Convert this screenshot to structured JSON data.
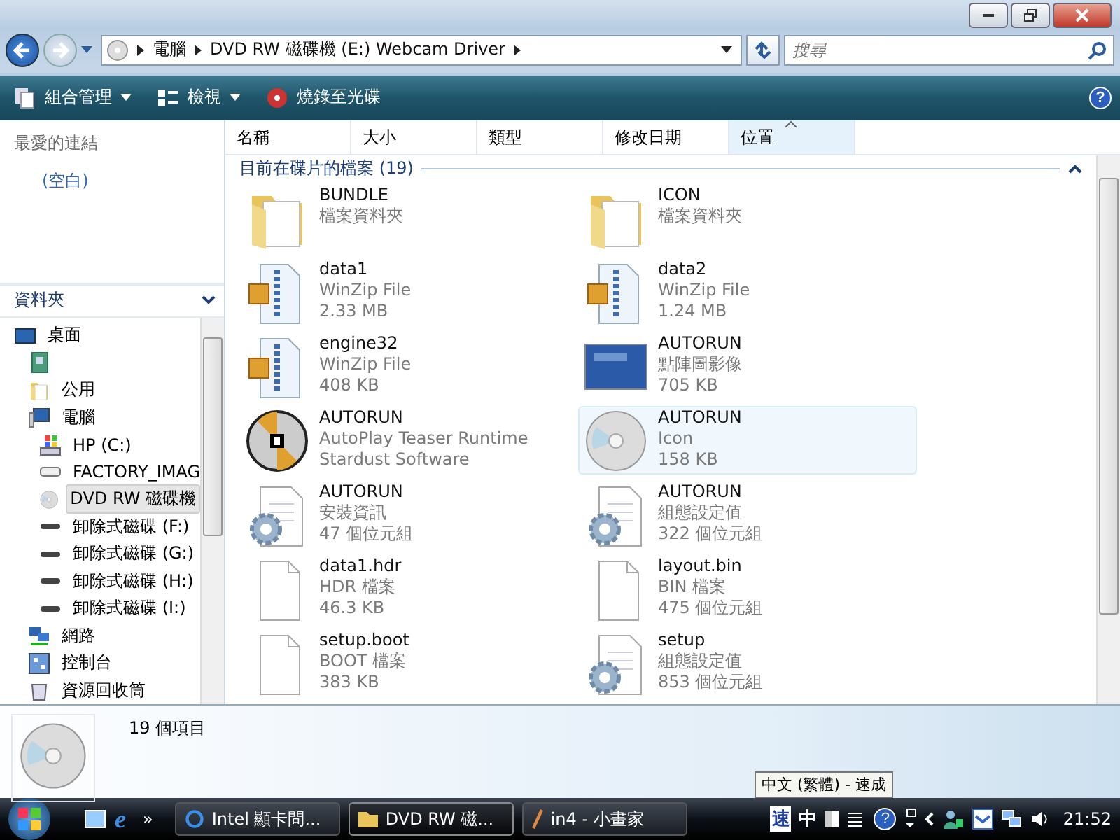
{
  "address_bar": {
    "crumbs": [
      "電腦",
      "DVD RW 磁碟機 (E:) Webcam Driver"
    ]
  },
  "search": {
    "placeholder": "搜尋"
  },
  "toolbar": {
    "help": "?",
    "items": [
      {
        "label": "組合管理",
        "dropdown": true
      },
      {
        "label": "檢視",
        "dropdown": true
      },
      {
        "label": "燒錄至光碟",
        "dropdown": false
      }
    ]
  },
  "favorites": {
    "title": "最愛的連結",
    "empty_text": "(空白)"
  },
  "folders": {
    "title": "資料夾",
    "tree": [
      {
        "label": "桌面",
        "kind": "desktop",
        "selected": false,
        "children": [
          {
            "kind": "contact",
            "selected": false
          },
          {
            "label": "公用",
            "kind": "folder",
            "selected": false
          },
          {
            "label": "電腦",
            "kind": "computer",
            "selected": false,
            "children": [
              {
                "label": "HP (C:)",
                "kind": "sysdrive",
                "selected": false
              },
              {
                "label": "FACTORY_IMAG",
                "kind": "drive",
                "selected": false
              },
              {
                "label": "DVD RW 磁碟機",
                "kind": "cd",
                "selected": true
              },
              {
                "label": "卸除式磁碟 (F:)",
                "kind": "removable",
                "selected": false
              },
              {
                "label": "卸除式磁碟 (G:)",
                "kind": "removable",
                "selected": false
              },
              {
                "label": "卸除式磁碟 (H:)",
                "kind": "removable",
                "selected": false
              },
              {
                "label": "卸除式磁碟 (I:)",
                "kind": "removable",
                "selected": false
              }
            ]
          },
          {
            "label": "網路",
            "kind": "network",
            "selected": false
          },
          {
            "label": "控制台",
            "kind": "control",
            "selected": false
          },
          {
            "label": "資源回收筒",
            "kind": "recycle",
            "selected": false
          }
        ]
      }
    ]
  },
  "table": {
    "columns": [
      {
        "label": "名稱",
        "selected": false
      },
      {
        "label": "大小",
        "selected": false
      },
      {
        "label": "類型",
        "selected": false
      },
      {
        "label": "修改日期",
        "selected": false
      },
      {
        "label": "位置",
        "selected": true
      }
    ],
    "group": "目前在碟片的檔案 (19)",
    "files": [
      {
        "name": "BUNDLE",
        "kind": "folder",
        "lines": [
          "檔案資料夾"
        ],
        "selected": false
      },
      {
        "name": "ICON",
        "kind": "folder",
        "lines": [
          "檔案資料夾"
        ],
        "selected": false
      },
      {
        "name": "data1",
        "kind": "zip",
        "lines": [
          "WinZip File",
          "2.33 MB"
        ],
        "selected": false
      },
      {
        "name": "data2",
        "kind": "zip",
        "lines": [
          "WinZip File",
          "1.24 MB"
        ],
        "selected": false
      },
      {
        "name": "engine32",
        "kind": "zip",
        "lines": [
          "WinZip File",
          "408 KB"
        ],
        "selected": false
      },
      {
        "name": "AUTORUN",
        "kind": "image",
        "lines": [
          "點陣圖影像",
          "705 KB"
        ],
        "selected": false
      },
      {
        "name": "AUTORUN",
        "kind": "autoplay",
        "lines": [
          "AutoPlay Teaser Runtime",
          "Stardust Software"
        ],
        "selected": false
      },
      {
        "name": "AUTORUN",
        "kind": "cd",
        "lines": [
          "Icon",
          "158 KB"
        ],
        "selected": true
      },
      {
        "name": "AUTORUN",
        "kind": "config",
        "lines": [
          "安裝資訊",
          "47 個位元組"
        ],
        "selected": false
      },
      {
        "name": "AUTORUN",
        "kind": "config",
        "lines": [
          "組態設定值",
          "322 個位元組"
        ],
        "selected": false
      },
      {
        "name": "data1.hdr",
        "kind": "blank",
        "lines": [
          "HDR 檔案",
          "46.3 KB"
        ],
        "selected": false
      },
      {
        "name": "layout.bin",
        "kind": "blank",
        "lines": [
          "BIN 檔案",
          "475 個位元組"
        ],
        "selected": false
      },
      {
        "name": "setup.boot",
        "kind": "blank",
        "lines": [
          "BOOT 檔案",
          "383 KB"
        ],
        "selected": false
      },
      {
        "name": "setup",
        "kind": "config",
        "lines": [
          "組態設定值",
          "853 個位元組"
        ],
        "selected": false
      }
    ]
  },
  "details": {
    "text": "19 個項目"
  },
  "taskbar": {
    "browser_glyph": "e",
    "help": "?",
    "overflow": "»",
    "tasks": [
      {
        "label": "Intel 顯卡問...",
        "selected": false
      },
      {
        "label": "DVD RW 磁...",
        "selected": true
      },
      {
        "label": "in4 - 小畫家",
        "selected": false
      }
    ],
    "tooltip": "中文 (繁體) - 速成",
    "ime": [
      "速",
      "中"
    ],
    "clock": "21:52"
  }
}
